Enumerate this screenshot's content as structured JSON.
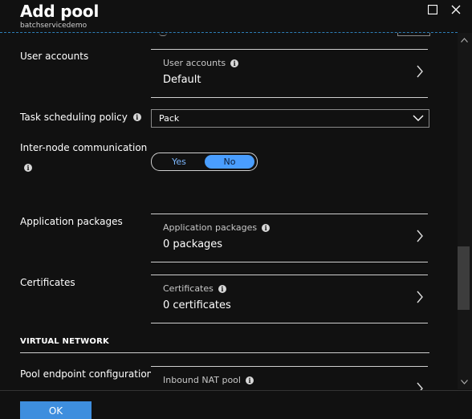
{
  "header": {
    "title": "Add pool",
    "subtitle": "batchservicedemo"
  },
  "user_accounts": {
    "section_label": "User accounts",
    "card_label": "User accounts",
    "card_value": "Default"
  },
  "task_scheduling": {
    "label": "Task scheduling policy",
    "selected": "Pack"
  },
  "inter_node": {
    "label": "Inter-node communication",
    "options": [
      "Yes",
      "No"
    ],
    "selected": "No"
  },
  "application_packages": {
    "section_label": "Application packages",
    "card_label": "Application packages",
    "card_value": "0 packages"
  },
  "certificates": {
    "section_label": "Certificates",
    "card_label": "Certificates",
    "card_value": "0 certificates"
  },
  "virtual_network": {
    "heading": "VIRTUAL NETWORK"
  },
  "pool_endpoint": {
    "section_label": "Pool endpoint configuration",
    "card_label": "Inbound NAT pool"
  },
  "footer": {
    "ok_label": "OK"
  },
  "colors": {
    "background": "#111111",
    "accent": "#4a9eff",
    "ok_button": "#3e8ede"
  },
  "icons": [
    "maximize-icon",
    "close-icon",
    "info-icon",
    "chevron-right-icon",
    "chevron-down-icon"
  ]
}
